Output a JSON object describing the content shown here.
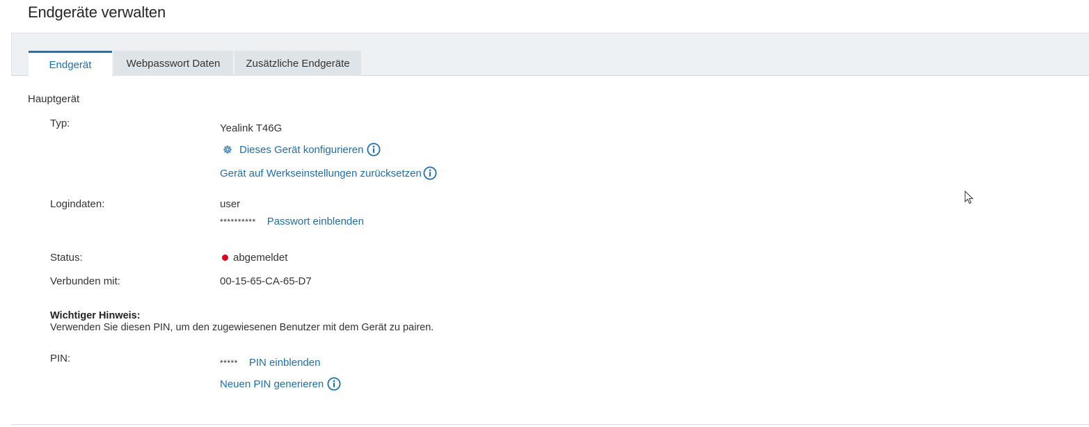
{
  "page": {
    "title": "Endgeräte verwalten"
  },
  "tabs": [
    {
      "label": "Endgerät",
      "active": true
    },
    {
      "label": "Webpasswort Daten",
      "active": false
    },
    {
      "label": "Zusätzliche Endgeräte",
      "active": false
    }
  ],
  "main_device": {
    "section_title": "Hauptgerät",
    "type_label": "Typ:",
    "type_value": "Yealink T46G",
    "configure_link": "Dieses Gerät konfigurieren",
    "factory_reset_link": "Gerät auf Werkseinstellungen zurücksetzen",
    "login_label": "Logindaten:",
    "login_user": "user",
    "login_password_masked": "**********",
    "show_password_link": "Passwort einblenden",
    "status_label": "Status:",
    "status_value": "abgemeldet",
    "status_color": "#e2001a",
    "connected_label": "Verbunden mit:",
    "connected_value": "00-15-65-CA-65-D7"
  },
  "notice": {
    "title": "Wichtiger Hinweis:",
    "text": "Verwenden Sie diesen PIN, um den zugewiesenen Benutzer mit dem Gerät zu pairen."
  },
  "pin": {
    "label": "PIN:",
    "masked": "*****",
    "show_pin_link": "PIN einblenden",
    "generate_link": "Neuen PIN generieren"
  },
  "colors": {
    "accent": "#1c6fb5",
    "tab_bar_bg": "#edf1f4",
    "inactive_tab_bg": "#dfe4e8"
  },
  "icons": {
    "configure": "gear-icon",
    "info": "info-icon",
    "status": "status-dot-icon"
  }
}
